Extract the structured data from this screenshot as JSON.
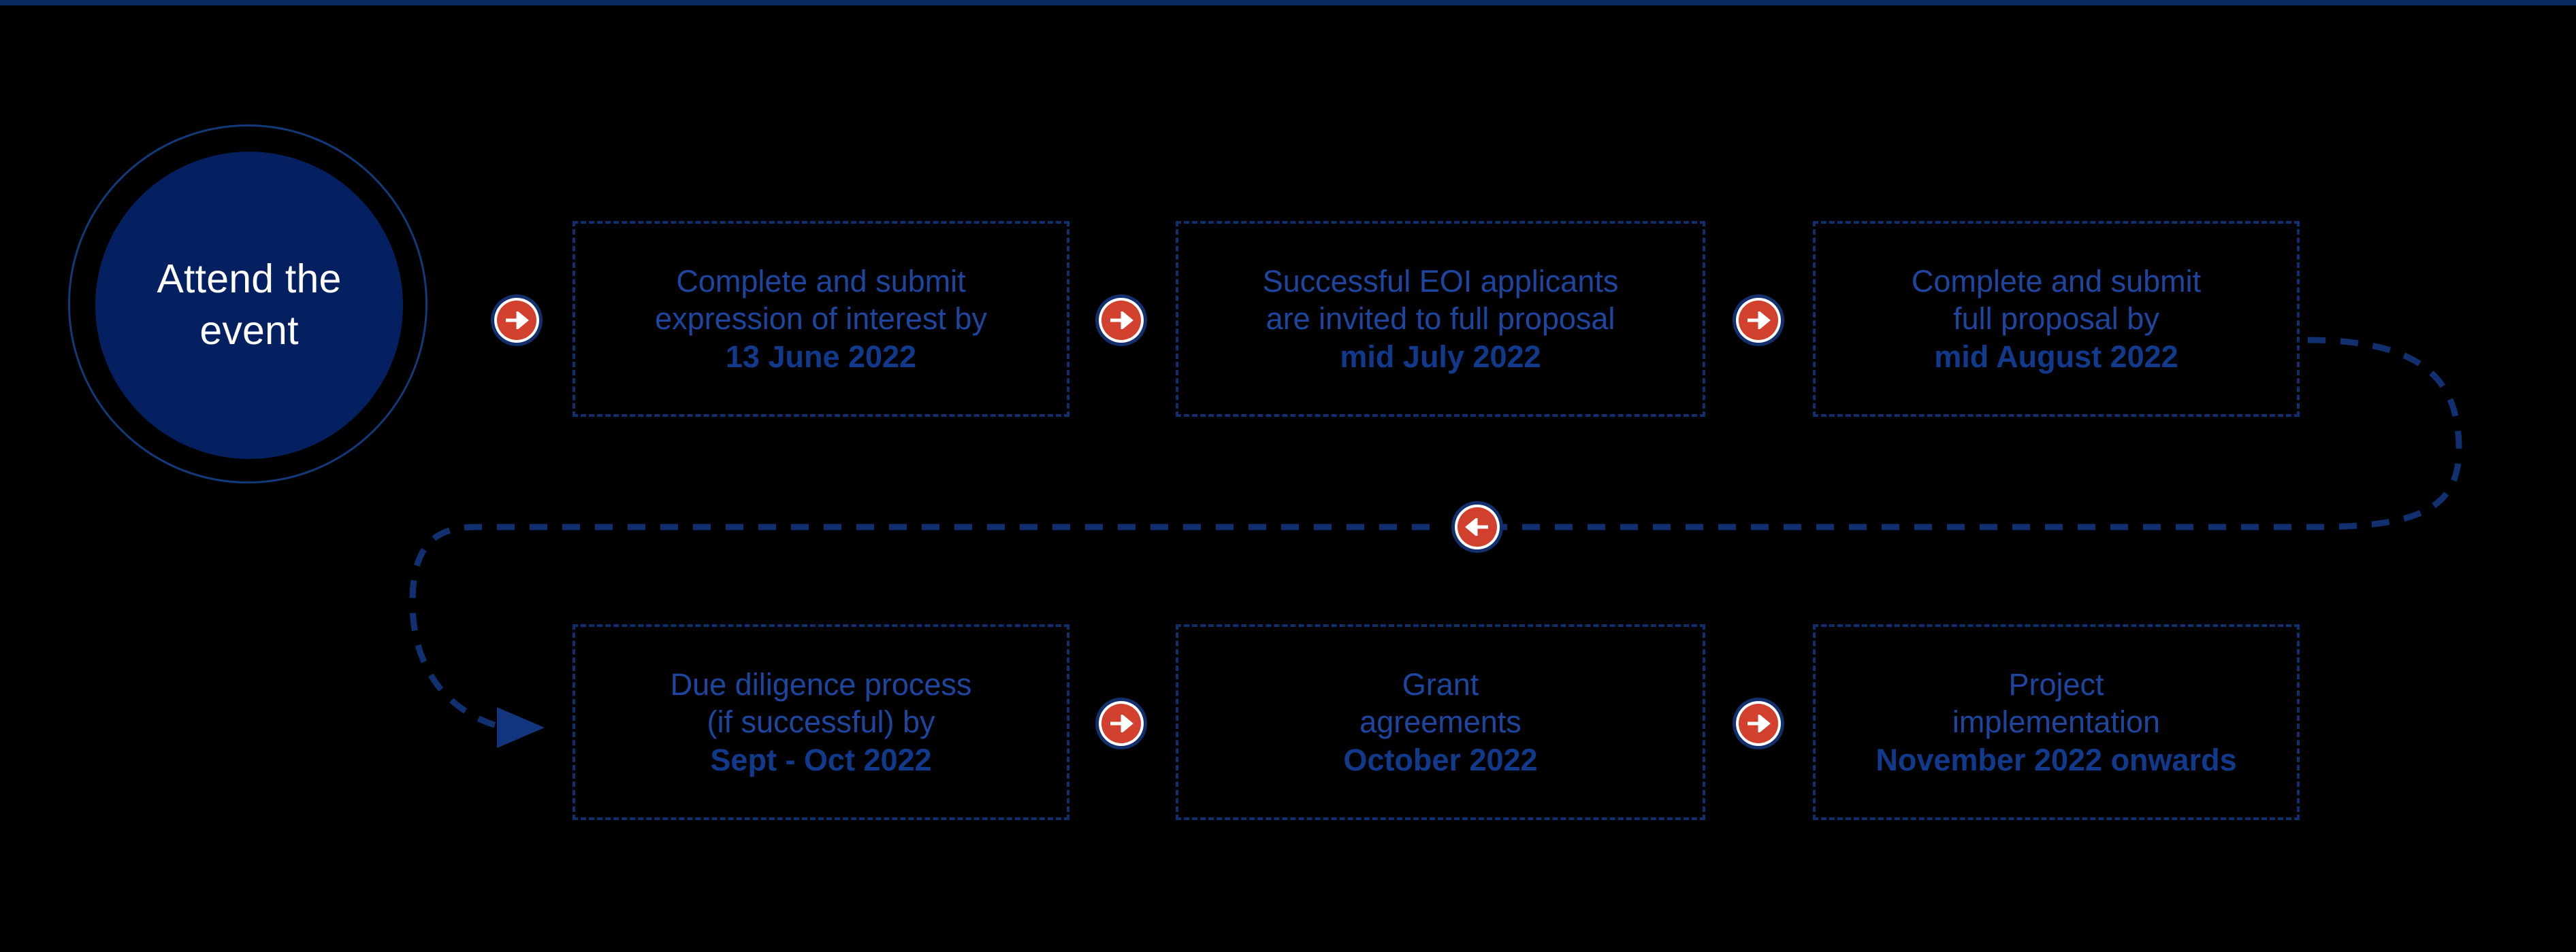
{
  "page": {
    "title": "Funding process timeline",
    "background_color": "#000000",
    "top_rule_color": "#0a2a63"
  },
  "theme": {
    "navy": "#042060",
    "dashed_border": "#0f2f6e",
    "text_blue": "#1e46a0",
    "emphasis_blue": "#123a8c",
    "badge_red": "#d2402e",
    "badge_ring": "#12306e",
    "white": "#ffffff"
  },
  "start_node": {
    "label": "Attend the event",
    "line1": "Attend the",
    "line2": "event",
    "shape": "circle"
  },
  "steps": [
    {
      "id": "step-1",
      "line1": "Complete and submit",
      "line2": "expression of interest by",
      "date": "13 June 2022"
    },
    {
      "id": "step-2",
      "line1": "Successful EOI applicants",
      "line2": "are invited to full proposal",
      "date": "mid July 2022"
    },
    {
      "id": "step-3",
      "line1": "Complete and submit",
      "line2": "full proposal by",
      "date": "mid August 2022"
    },
    {
      "id": "step-4",
      "line1": "Due diligence process",
      "line2": "(if successful) by",
      "date": "Sept - Oct 2022"
    },
    {
      "id": "step-5",
      "line1": "Grant",
      "line2": "agreements",
      "date": "October 2022"
    },
    {
      "id": "step-6",
      "line1": "Project",
      "line2": "implementation",
      "date": "November 2022 onwards"
    }
  ],
  "connectors": [
    {
      "id": "badge-1",
      "icon": "arrow-right-icon",
      "direction": "right"
    },
    {
      "id": "badge-2",
      "icon": "arrow-right-icon",
      "direction": "right"
    },
    {
      "id": "badge-3",
      "icon": "arrow-right-icon",
      "direction": "right"
    },
    {
      "id": "badge-mid",
      "icon": "arrow-left-icon",
      "direction": "left"
    },
    {
      "id": "badge-4",
      "icon": "arrow-right-icon",
      "direction": "right"
    },
    {
      "id": "badge-5",
      "icon": "arrow-right-icon",
      "direction": "right"
    }
  ]
}
